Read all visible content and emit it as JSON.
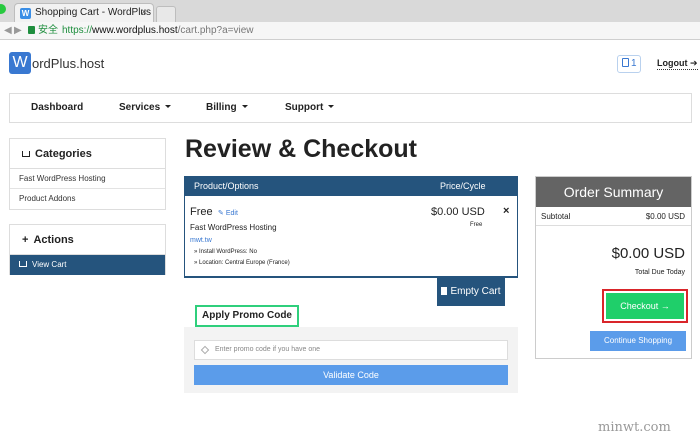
{
  "browser": {
    "tab_title": "Shopping Cart - WordPlus",
    "tab_favicon": "W",
    "tab_close": "×",
    "secure_label": "安全",
    "url_scheme": "https://",
    "url_host": "www.wordplus.host",
    "url_path": "/cart.php?a=view"
  },
  "site": {
    "logo_letter": "W",
    "logo_text": "ordPlus.host",
    "cart_count": "1",
    "logout_label": "Logout"
  },
  "nav": {
    "items": [
      "Dashboard",
      "Services",
      "Billing",
      "Support"
    ]
  },
  "sidebar": {
    "categories_title": "Categories",
    "categories": [
      "Fast WordPress Hosting",
      "Product Addons"
    ],
    "actions_title": "Actions",
    "actions": [
      "View Cart"
    ]
  },
  "main": {
    "title": "Review & Checkout",
    "table_headers": [
      "Product/Options",
      "Price/Cycle"
    ],
    "item": {
      "price_label": "Free",
      "edit_label": "Edit",
      "product_name": "Fast WordPress Hosting",
      "domain": "mwt.tw",
      "options": [
        "» Install WordPress: No",
        "» Location: Central Europe (France)"
      ],
      "amount": "$0.00 USD",
      "cycle": "Free",
      "remove": "×"
    },
    "empty_cart_label": "Empty Cart",
    "promo_tab_label": "Apply Promo Code",
    "promo_placeholder": "Enter promo code if you have one",
    "validate_label": "Validate Code"
  },
  "summary": {
    "title": "Order Summary",
    "subtotal_label": "Subtotal",
    "subtotal_value": "$0.00 USD",
    "total_value": "$0.00 USD",
    "total_label": "Total Due Today",
    "checkout_label": "Checkout →",
    "continue_label": "Continue Shopping"
  },
  "watermark": "minwt.com",
  "colors": {
    "brand_blue": "#3978d1",
    "table_navy": "#25547d",
    "checkout_green": "#1fcf6a",
    "highlight_red": "#d9252a",
    "promo_green": "#2fcf7c",
    "button_blue": "#5b9cea"
  }
}
